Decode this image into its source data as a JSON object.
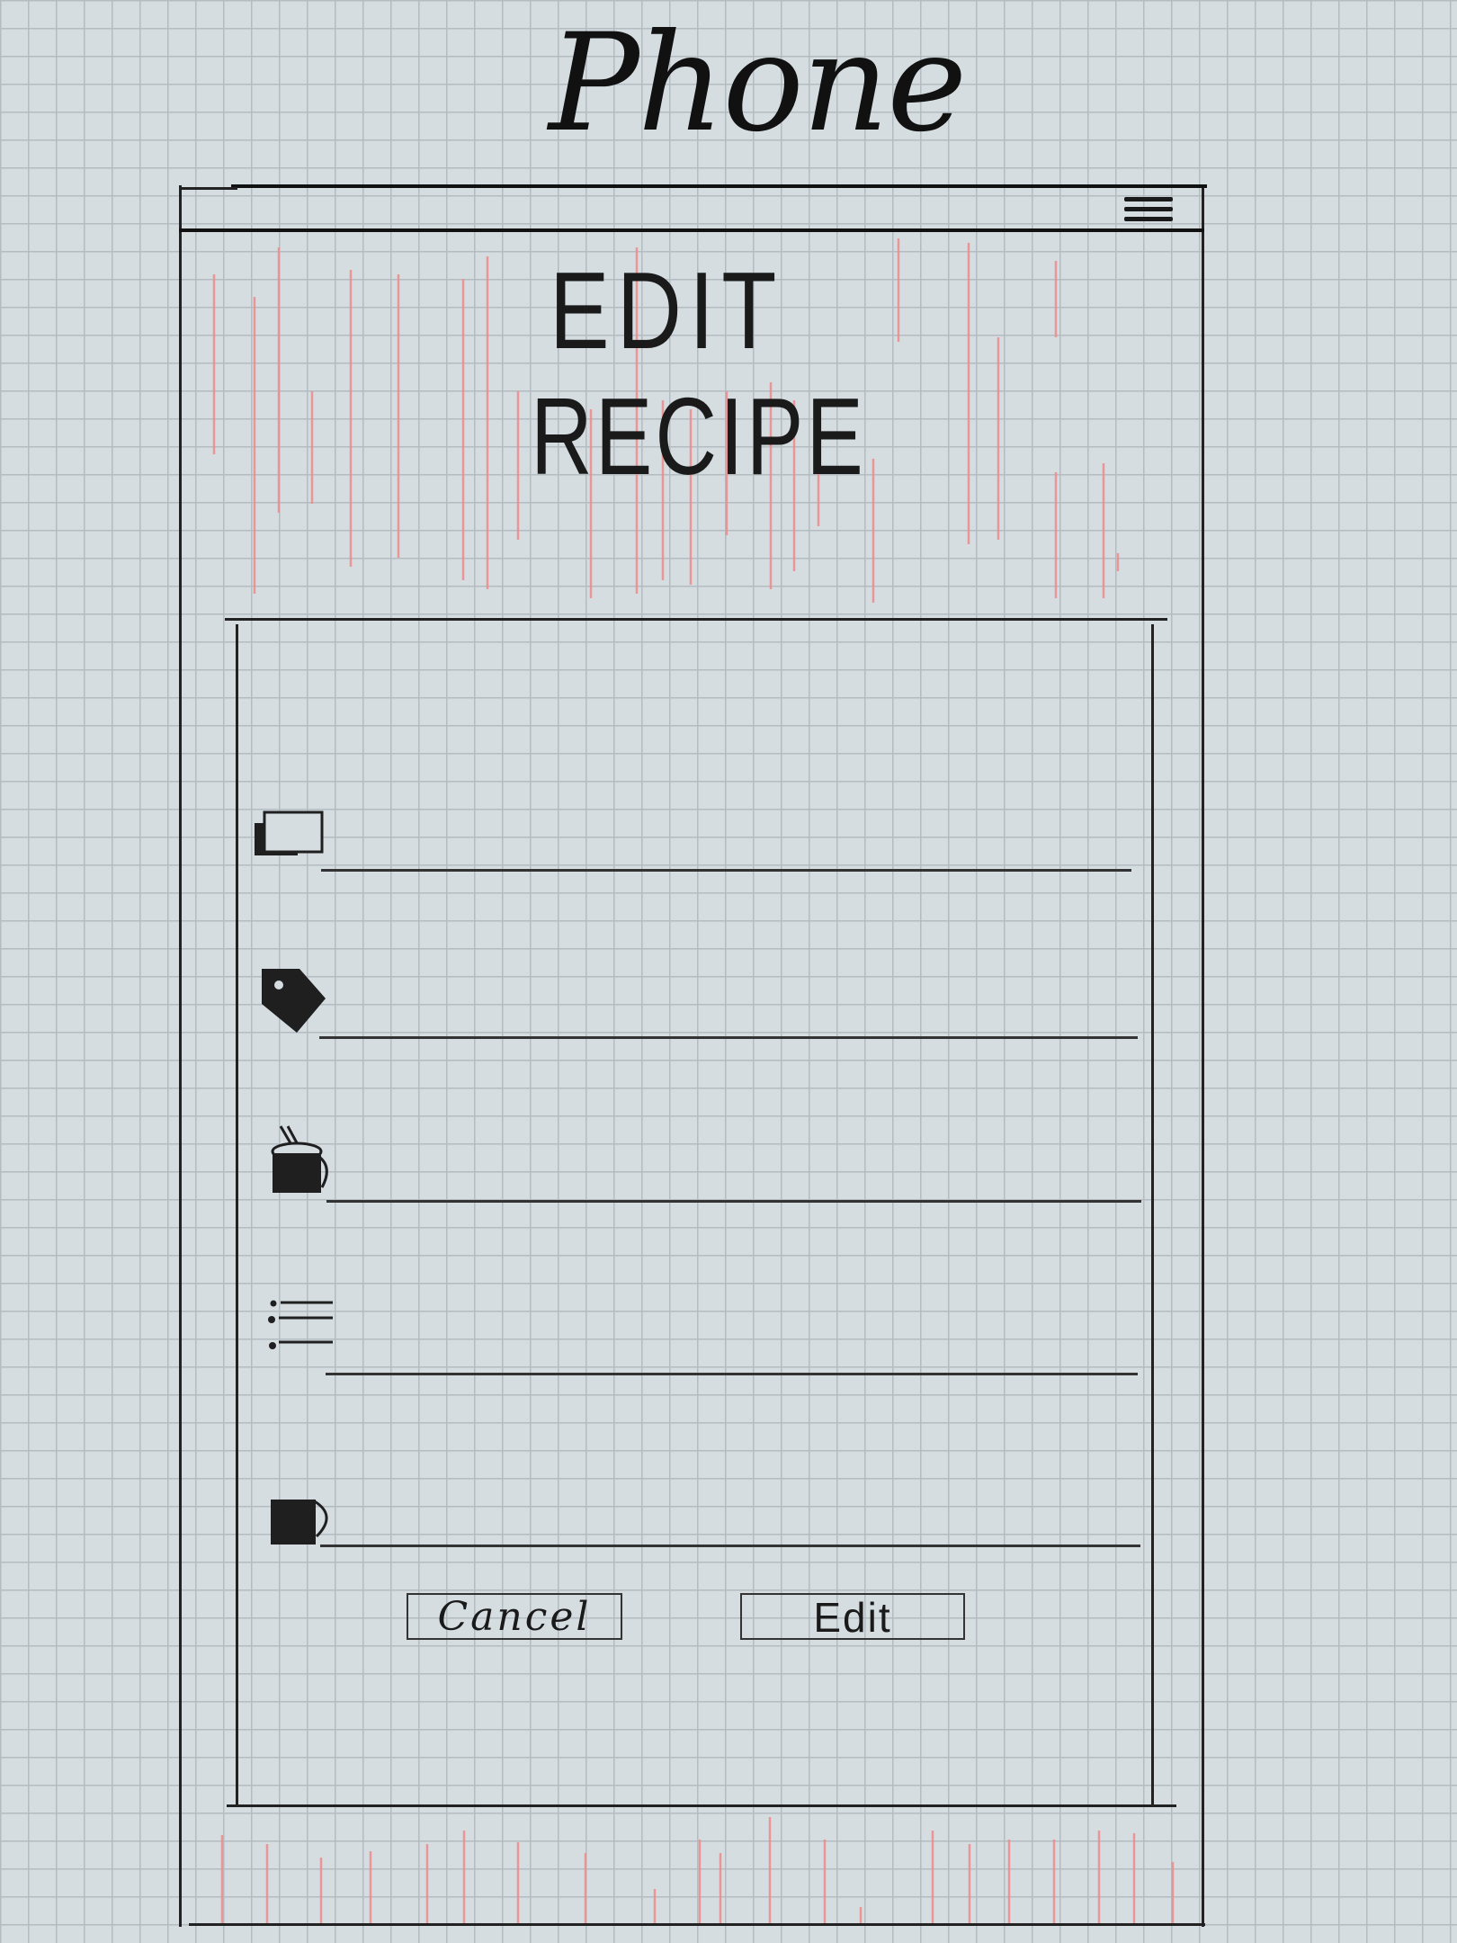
{
  "page": {
    "title": "Phone"
  },
  "header": {
    "menu_icon": "hamburger-menu-icon"
  },
  "main": {
    "heading_line1": "EDIT",
    "heading_line2": "RECIPE"
  },
  "form": {
    "fields": [
      {
        "name": "photo-field",
        "icon": "image-icon",
        "value": ""
      },
      {
        "name": "tags-field",
        "icon": "tag-icon",
        "value": ""
      },
      {
        "name": "cooking-field",
        "icon": "pot-icon",
        "value": ""
      },
      {
        "name": "ingredients-field",
        "icon": "list-icon",
        "value": ""
      },
      {
        "name": "servings-field",
        "icon": "cup-icon",
        "value": ""
      }
    ]
  },
  "actions": {
    "cancel_label": "Cancel",
    "edit_label": "Edit"
  },
  "colors": {
    "paper": "#d5dde1",
    "grid": "#b3bcc1",
    "ink": "#1c1c1c",
    "marker_red": "#f08a8a"
  }
}
